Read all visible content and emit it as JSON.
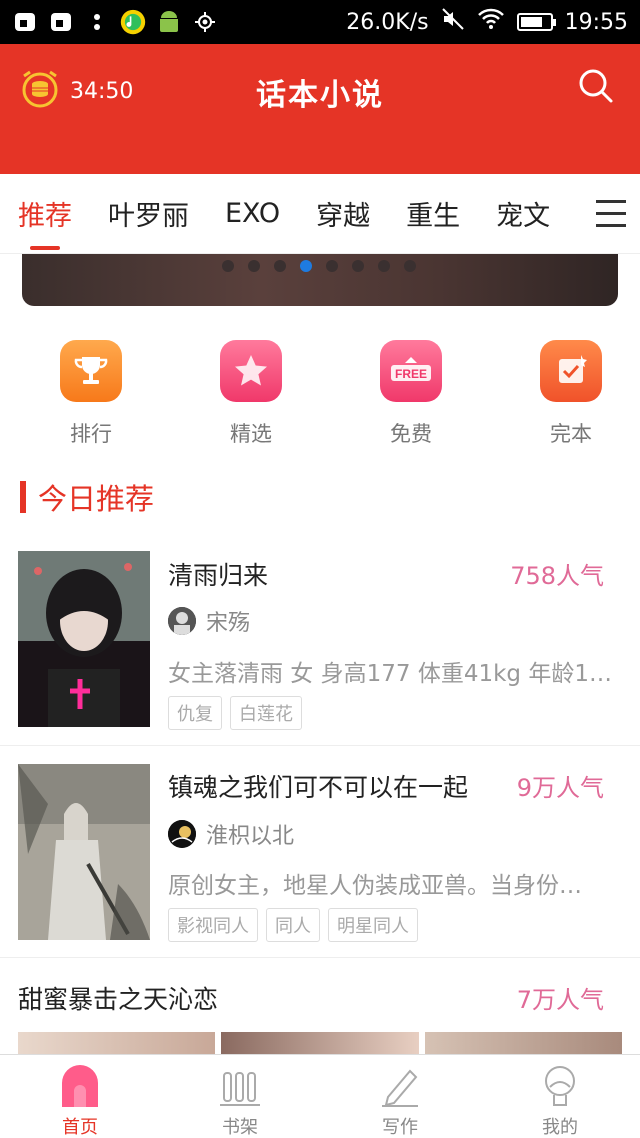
{
  "status_bar": {
    "net_speed": "26.0K/s",
    "time": "19:55",
    "battery_level": 0.75
  },
  "header": {
    "timer": "34:50",
    "title": "话本小说"
  },
  "tabs": [
    "推荐",
    "叶罗丽",
    "EXO",
    "穿越",
    "重生",
    "宠文"
  ],
  "active_tab": 0,
  "banner": {
    "dot_count": 8,
    "active_dot": 3
  },
  "categories": [
    {
      "label": "排行",
      "icon": "trophy-icon",
      "color": "#f7933a"
    },
    {
      "label": "精选",
      "icon": "star-icon",
      "color": "#f4587c"
    },
    {
      "label": "免费",
      "icon": "free-icon",
      "color": "#f4587c",
      "badge_text": "FREE"
    },
    {
      "label": "完本",
      "icon": "check-icon",
      "color": "#f46a3a"
    }
  ],
  "section": {
    "title": "今日推荐"
  },
  "books": [
    {
      "title": "清雨归来",
      "popularity": "758人气",
      "author": "宋殇",
      "desc": "女主落清雨 女 身高177 体重41kg 年龄1…",
      "tags": [
        "仇复",
        "白莲花"
      ]
    },
    {
      "title": "镇魂之我们可不可以在一起",
      "popularity": "9万人气",
      "author": "淮枳以北",
      "desc": "原创女主，地星人伪装成亚兽。当身份…",
      "tags": [
        "影视同人",
        "同人",
        "明星同人"
      ]
    },
    {
      "title": "甜蜜暴击之天沁恋",
      "popularity": "7万人气"
    }
  ],
  "bottom_nav": [
    {
      "label": "首页",
      "icon": "home-icon"
    },
    {
      "label": "书架",
      "icon": "bookshelf-icon"
    },
    {
      "label": "写作",
      "icon": "pen-icon"
    },
    {
      "label": "我的",
      "icon": "profile-icon"
    }
  ],
  "colors": {
    "brand": "#e53426",
    "popularity": "#e06a97"
  }
}
